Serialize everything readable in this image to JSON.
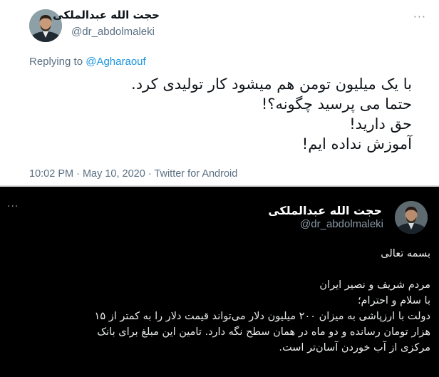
{
  "reply_tweet": {
    "display_name": "حجت الله عبدالملکی",
    "handle": "@dr_abdolmaleki",
    "replying_to_prefix": "Replying to",
    "replying_to_user": "@Agharaouf",
    "more_icon": "more-horizontal-icon",
    "body_lines": [
      "با یک میلیون تومن هم میشود کار تولیدی کرد.",
      "حتما می پرسید چگونه؟!",
      "حق دارید!",
      "آموزش نداده ایم!"
    ],
    "meta": "10:02 PM · May 10, 2020 · Twitter for Android"
  },
  "quoted_tweet": {
    "display_name": "حجت الله عبدالملکی",
    "handle": "@dr_abdolmaleki",
    "more_icon": "more-horizontal-icon",
    "body_lines": [
      "بسمه تعالی",
      "",
      "مردم شریف و نصیر ایران",
      "با سلام و احترام؛",
      "دولت با ارزپاشی به میزان ۲۰۰ میلیون دلار می‌تواند قیمت دلار را به کمتر از ۱۵",
      "هزار تومان رسانده و دو ماه در همان سطح نگه دارد. تامین این مبلغ برای بانک",
      "مرکزی از آب خوردن آسان‌تر است."
    ]
  }
}
